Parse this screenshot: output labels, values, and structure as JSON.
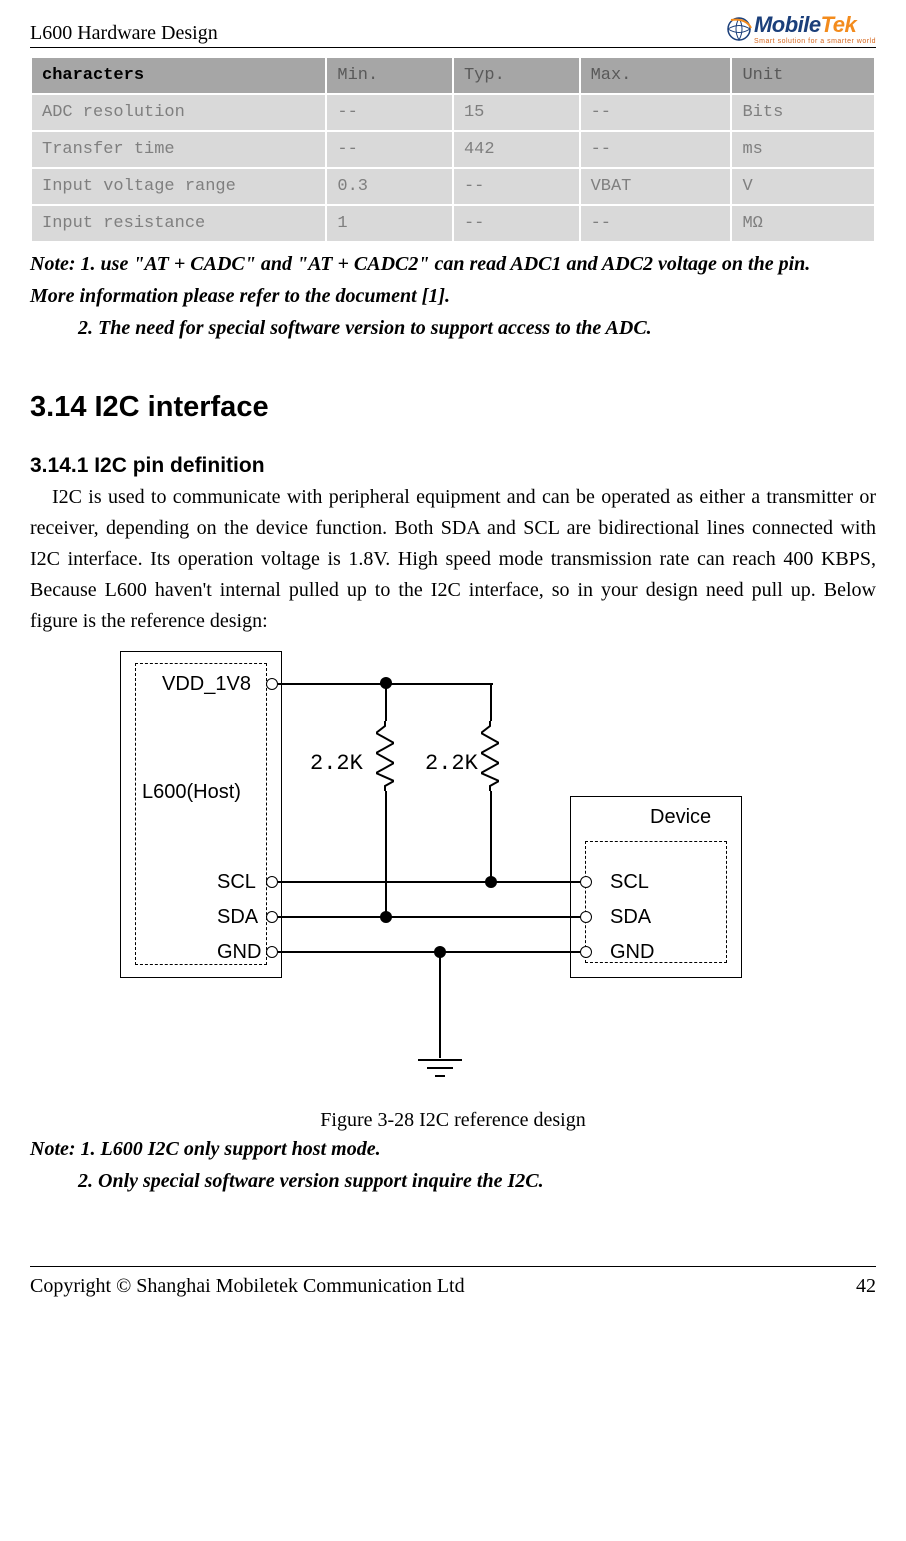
{
  "header": {
    "title": "L600 Hardware Design",
    "logo_main_left": "Mobile",
    "logo_main_right": "Tek",
    "logo_tag": "Smart solution for a smarter world"
  },
  "table": {
    "cols": [
      "characters",
      "Min.",
      "Typ.",
      "Max.",
      "Unit"
    ],
    "rows": [
      [
        "ADC resolution",
        "--",
        "15",
        "--",
        "Bits"
      ],
      [
        "Transfer time",
        "--",
        "442",
        "--",
        "ms"
      ],
      [
        "Input voltage range",
        "0.3",
        "--",
        "VBAT",
        "V"
      ],
      [
        "Input resistance",
        "1",
        "--",
        "--",
        "MΩ"
      ]
    ]
  },
  "notes1": {
    "l1": "Note: 1. use \"AT + CADC\" and \"AT + CADC2\" can read ADC1 and ADC2 voltage on the pin.",
    "l2": "More information please refer to the document [1].",
    "l3": "2. The need for special software version to support access to the ADC."
  },
  "sec314": {
    "h2": "3.14 I2C interface",
    "h3": "3.14.1 I2C pin definition",
    "body": "I2C is used to communicate with peripheral equipment and can be operated as either a transmitter or receiver, depending on the device function. Both SDA and SCL are bidirectional lines connected with I2C interface. Its operation voltage is 1.8V. High speed mode transmission rate can reach 400 KBPS, Because L600 haven't internal pulled up to the I2C interface, so in your design need pull up. Below figure is the reference design:"
  },
  "diagram": {
    "vdd": "VDD_1V8",
    "host": "L600(Host)",
    "device": "Device",
    "scl": "SCL",
    "sda": "SDA",
    "gnd": "GND",
    "r1": "2.2K",
    "r2": "2.2K"
  },
  "caption": "Figure 3-28 I2C reference design",
  "notes2": {
    "l1": "Note: 1. L600 I2C only support host mode.",
    "l2": "2. Only special software version support inquire the I2C."
  },
  "footer": {
    "left": "Copyright © Shanghai Mobiletek Communication Ltd",
    "right": "42"
  },
  "chart_data": {
    "type": "circuit-diagram",
    "host": {
      "name": "L600(Host)",
      "pins": [
        "VDD_1V8",
        "SCL",
        "SDA",
        "GND"
      ]
    },
    "device": {
      "name": "Device",
      "pins": [
        "SCL",
        "SDA",
        "GND"
      ]
    },
    "pull_up_resistors": [
      {
        "value": "2.2K",
        "from": "VDD_1V8",
        "to": "SCL"
      },
      {
        "value": "2.2K",
        "from": "VDD_1V8",
        "to": "SDA"
      }
    ],
    "connections": [
      {
        "from": "L600.SCL",
        "to": "Device.SCL"
      },
      {
        "from": "L600.SDA",
        "to": "Device.SDA"
      },
      {
        "from": "L600.GND",
        "to": "Device.GND"
      },
      {
        "from": "GND",
        "to": "ground-symbol"
      }
    ]
  }
}
